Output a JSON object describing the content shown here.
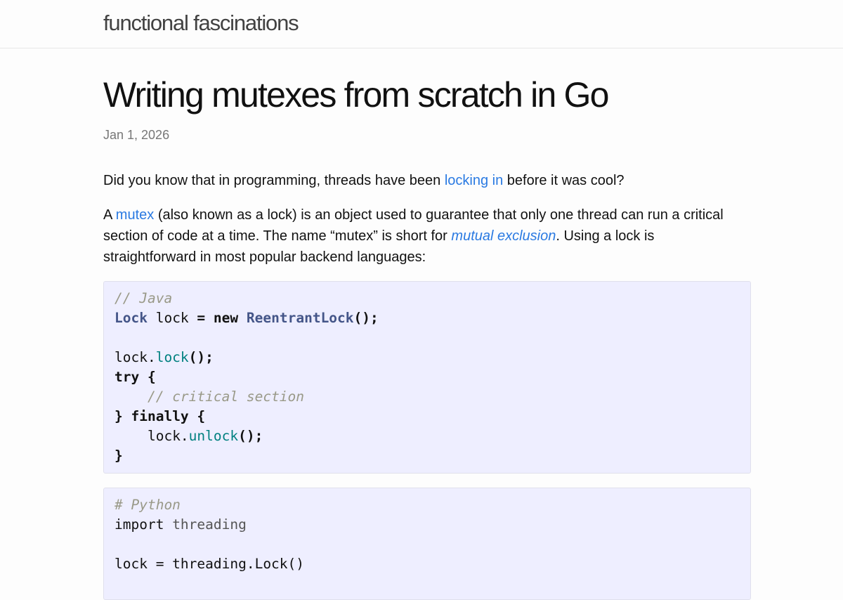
{
  "header": {
    "site_title": "functional fascinations"
  },
  "post": {
    "title": "Writing mutexes from scratch in Go",
    "date": "Jan 1, 2026",
    "p1": {
      "before": "Did you know that in programming, threads have been ",
      "link": "locking in",
      "after": " before it was cool?"
    },
    "p2": {
      "t1": "A ",
      "link_mutex": "mutex",
      "t2": " (also known as a lock) is an object used to guarantee that only one thread can run a critical section of code at a time. The name “mutex” is short for ",
      "link_mutual": "mutual exclusion",
      "t3": ". Using a lock is straightforward in most popular backend languages:"
    }
  },
  "code_java": {
    "comment": "// Java",
    "l2_type": "Lock",
    "l2_mid": " lock ",
    "l2_eq": "=",
    "l2_sp": " ",
    "l2_new": "new",
    "l2_sp2": " ",
    "l2_ctor": "ReentrantLock",
    "l2_end": "();",
    "l4_obj": "lock.",
    "l4_method": "lock",
    "l4_end": "();",
    "l5_try": "try",
    "l5_brace": " {",
    "l6_indent": "    ",
    "l6_comment": "// critical section",
    "l7_close": "}",
    "l7_finally": " finally",
    "l7_brace": " {",
    "l8_indent": "    ",
    "l8_obj": "lock.",
    "l8_method": "unlock",
    "l8_end": "();",
    "l9_close": "}"
  },
  "code_python": {
    "comment": "# Python",
    "l2_import": "import",
    "l2_module": " threading",
    "l4_text": "lock = threading.Lock()"
  }
}
